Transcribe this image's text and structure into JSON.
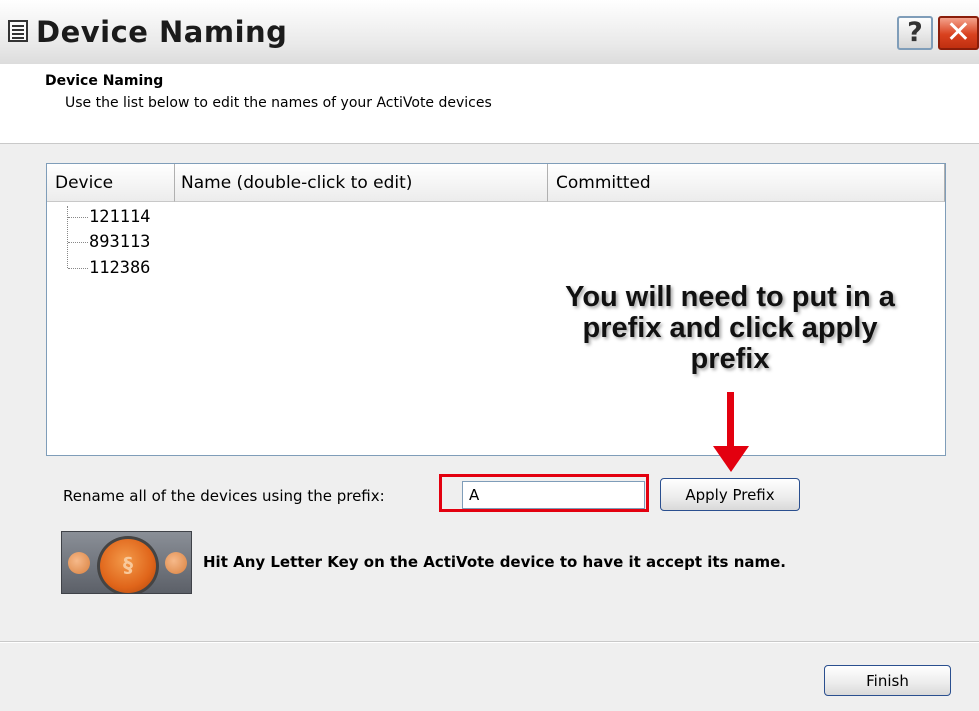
{
  "window": {
    "title": "Device Naming",
    "help_label": "?",
    "close_label": "✕"
  },
  "header": {
    "title": "Device Naming",
    "subtitle": "Use the list below to edit the names of your ActiVote devices"
  },
  "list": {
    "columns": [
      "Device",
      "Name (double-click to edit)",
      "Committed"
    ],
    "devices": [
      "121114",
      "893113",
      "112386"
    ]
  },
  "prefix": {
    "label": "Rename all of the devices using the prefix:",
    "value": "A",
    "apply_label": "Apply Prefix"
  },
  "annotation": {
    "text": "You will need to put in a prefix and click apply prefix",
    "color": "#e3000f"
  },
  "hint": {
    "text": "Hit Any Letter Key on the ActiVote device to have it accept its name."
  },
  "footer": {
    "finish_label": "Finish"
  }
}
